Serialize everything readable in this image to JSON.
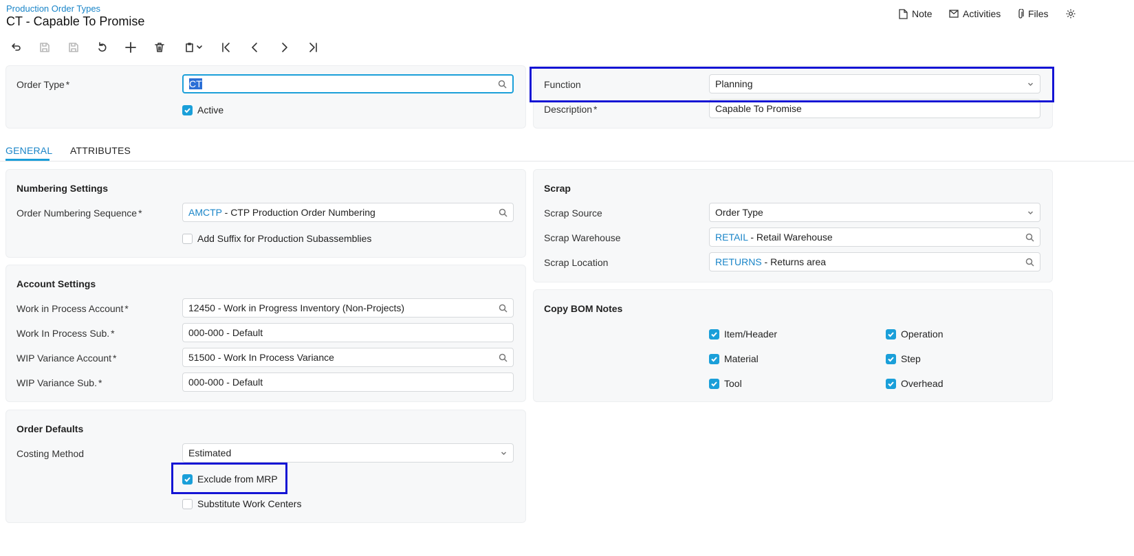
{
  "breadcrumb": "Production Order Types",
  "title": "CT - Capable To Promise",
  "topbar": {
    "note": "Note",
    "activities": "Activities",
    "files": "Files"
  },
  "header": {
    "order_type_label": "Order Type",
    "order_type_value": "CT",
    "active_label": "Active",
    "active_checked": true,
    "function_label": "Function",
    "function_value": "Planning",
    "description_label": "Description",
    "description_value": "Capable To Promise",
    "required_mark": "*"
  },
  "tabs": [
    "GENERAL",
    "ATTRIBUTES"
  ],
  "numbering": {
    "title": "Numbering Settings",
    "sequence_label": "Order Numbering Sequence",
    "sequence_code": "AMCTP",
    "sequence_desc": " - CTP Production Order Numbering",
    "suffix_label": "Add Suffix for Production Subassemblies",
    "suffix_checked": false
  },
  "accounts": {
    "title": "Account Settings",
    "wip_account_label": "Work in Process Account",
    "wip_account_value": "12450 - Work in Progress Inventory (Non-Projects)",
    "wip_sub_label": "Work In Process Sub.",
    "wip_sub_value": "000-000 - Default",
    "var_account_label": "WIP Variance Account",
    "var_account_value": "51500 - Work In Process Variance",
    "var_sub_label": "WIP Variance Sub.",
    "var_sub_value": "000-000 - Default"
  },
  "defaults": {
    "title": "Order Defaults",
    "costing_label": "Costing Method",
    "costing_value": "Estimated",
    "exclude_label": "Exclude from MRP",
    "exclude_checked": true,
    "substitute_label": "Substitute Work Centers",
    "substitute_checked": false
  },
  "scrap": {
    "title": "Scrap",
    "source_label": "Scrap Source",
    "source_value": "Order Type",
    "warehouse_label": "Scrap Warehouse",
    "warehouse_code": "RETAIL",
    "warehouse_desc": " - Retail Warehouse",
    "location_label": "Scrap Location",
    "location_code": "RETURNS",
    "location_desc": " - Returns area"
  },
  "bom_notes": {
    "title": "Copy BOM Notes",
    "item_header": "Item/Header",
    "operation": "Operation",
    "material": "Material",
    "step": "Step",
    "tool": "Tool",
    "overhead": "Overhead"
  },
  "colors": {
    "accent": "#1a9fd9",
    "link": "#1a85c8",
    "highlight": "#1414d4"
  }
}
